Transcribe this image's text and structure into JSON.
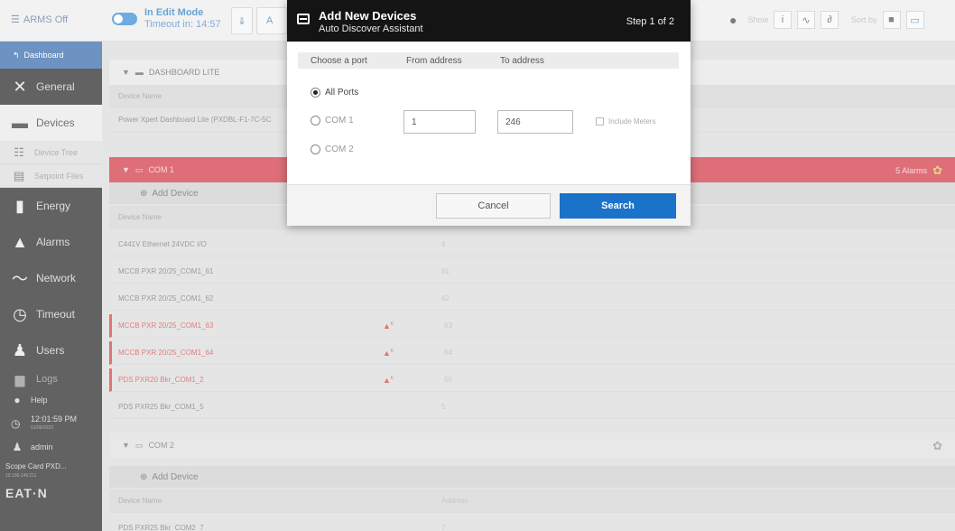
{
  "topbar": {
    "arms_label": "ARMS Off",
    "edit_mode_label": "In Edit Mode",
    "timeout_label": "Timeout in: 14:57",
    "partial_button_label": "A",
    "show_label": "Show",
    "sort_label": "Sort by"
  },
  "sidebar": {
    "dashboard_label": "Dashboard",
    "items": [
      {
        "label": "General",
        "icon": "tools-icon"
      },
      {
        "label": "Devices",
        "icon": "devices-icon"
      },
      {
        "label": "Device Tree",
        "icon": "tree-icon"
      },
      {
        "label": "Setpoint Files",
        "icon": "file-icon"
      },
      {
        "label": "Energy",
        "icon": "bar-chart-icon"
      },
      {
        "label": "Alarms",
        "icon": "bell-icon"
      },
      {
        "label": "Network",
        "icon": "network-icon"
      },
      {
        "label": "Timeout",
        "icon": "timer-icon"
      },
      {
        "label": "Users",
        "icon": "users-icon"
      },
      {
        "label": "Logs",
        "icon": "logs-icon"
      }
    ],
    "help_label": "Help",
    "time": "12:01:59 PM",
    "date": "01/06/2023",
    "user": "admin",
    "scope_name": "Scope Card PXD...",
    "scope_ip": "10.130.149.211",
    "logo_text": "EAT·N"
  },
  "main": {
    "dash_section": {
      "title": "DASHBOARD LITE",
      "col_device_name": "Device Name",
      "rows": [
        "Power Xpert Dashboard Lite (PXDBL-F1-7C-5C"
      ]
    },
    "com1_section": {
      "title": "COM 1",
      "alarms_label": "5 Alarms",
      "add_device_label": "Add Device",
      "col_device_name": "Device Name",
      "rows": [
        {
          "name": "C441V Ethernet 24VDC I/O",
          "address": "4",
          "alarm": false
        },
        {
          "name": "MCCB PXR 20/25_COM1_61",
          "address": "61",
          "alarm": false
        },
        {
          "name": "MCCB PXR 20/25_COM1_62",
          "address": "62",
          "alarm": false
        },
        {
          "name": "MCCB PXR 20/25_COM1_63",
          "address": "63",
          "alarm": true,
          "count": "6"
        },
        {
          "name": "MCCB PXR 20/25_COM1_64",
          "address": "64",
          "alarm": true,
          "count": "6"
        },
        {
          "name": "PDS PXR20 Bkr_COM1_2",
          "address": "55",
          "alarm": true,
          "count": "6"
        },
        {
          "name": "PDS PXR25 Bkr_COM1_5",
          "address": "5",
          "alarm": false
        }
      ]
    },
    "com2_section": {
      "title": "COM 2",
      "add_device_label": "Add Device",
      "col_device_name": "Device Name",
      "col_address": "Address",
      "rows": [
        {
          "name": "PDS PXR25 Bkr_COM2_7",
          "address": "7"
        }
      ]
    }
  },
  "modal": {
    "title": "Add New Devices",
    "subtitle": "Auto Discover Assistant",
    "step": "Step 1 of 2",
    "col_port": "Choose a port",
    "col_from": "From address",
    "col_to": "To address",
    "options": [
      {
        "label": "All Ports",
        "selected": true
      },
      {
        "label": "COM 1",
        "selected": false
      },
      {
        "label": "COM 2",
        "selected": false
      }
    ],
    "from_value": "1",
    "to_value": "246",
    "include_meters_label": "Include Meters",
    "cancel_label": "Cancel",
    "search_label": "Search"
  },
  "colors": {
    "accent_blue": "#1a73c8",
    "alarm_red": "#cd2231",
    "sidebar_bg": "#0f0f0f"
  }
}
